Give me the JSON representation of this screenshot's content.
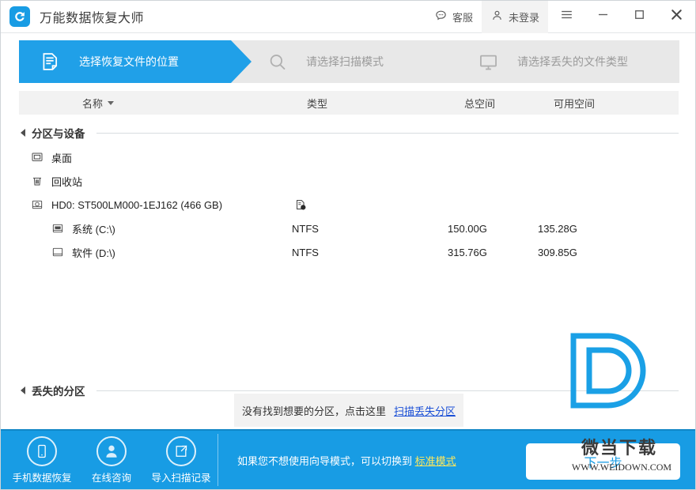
{
  "window": {
    "app_title": "万能数据恢复大师",
    "logo_icon": "recovery-circular-arrow-icon",
    "support_label": "客服",
    "support_icon": "chat-bubble-icon",
    "login_label": "未登录",
    "login_icon": "user-icon",
    "menu_icon": "hamburger-menu-icon",
    "minimize_icon": "minimize-icon",
    "maximize_icon": "maximize-icon",
    "close_icon": "close-icon",
    "accent_color": "#189ce4"
  },
  "steps": [
    {
      "label": "选择恢复文件的位置",
      "icon": "document-icon",
      "active": true
    },
    {
      "label": "请选择扫描模式",
      "icon": "search-icon",
      "active": false
    },
    {
      "label": "请选择丢失的文件类型",
      "icon": "monitor-icon",
      "active": false
    }
  ],
  "columns": {
    "name": "名称",
    "type": "类型",
    "total": "总空间",
    "free": "可用空间",
    "sort_icon": "sort-caret-down-icon"
  },
  "groups": {
    "devices": "分区与设备",
    "lost": "丢失的分区"
  },
  "rows": [
    {
      "name": "桌面",
      "icon": "desktop-icon",
      "indent": 0,
      "type": "",
      "total": "",
      "free": "",
      "badge": ""
    },
    {
      "name": "回收站",
      "icon": "recycle-bin-icon",
      "indent": 0,
      "type": "",
      "total": "",
      "free": "",
      "badge": ""
    },
    {
      "name": "HD0: ST500LM000-1EJ162 (466 GB)",
      "icon": "hard-disk-icon",
      "indent": 0,
      "type": "",
      "total": "",
      "free": "",
      "badge": "disk-info-badge-icon"
    },
    {
      "name": "系统 (C:\\)",
      "icon": "os-drive-icon",
      "indent": 1,
      "type": "NTFS",
      "total": "150.00G",
      "free": "135.28G",
      "badge": ""
    },
    {
      "name": "软件 (D:\\)",
      "icon": "drive-icon",
      "indent": 1,
      "type": "NTFS",
      "total": "315.76G",
      "free": "309.85G",
      "badge": ""
    }
  ],
  "notice": {
    "text": "没有找到想要的分区，点击这里",
    "link": "扫描丢失分区"
  },
  "bottom": {
    "quick_actions": [
      {
        "label": "手机数据恢复",
        "icon": "phone-icon"
      },
      {
        "label": "在线咨询",
        "icon": "person-icon"
      },
      {
        "label": "导入扫描记录",
        "icon": "import-icon"
      }
    ],
    "hint_text": "如果您不想使用向导模式，可以切换到",
    "hint_link": "标准模式",
    "next_label": "下一步"
  },
  "watermark": {
    "logo": "letter-d-logo",
    "text": "微当下载",
    "url": "WWW.WEIDOWN.COM"
  }
}
